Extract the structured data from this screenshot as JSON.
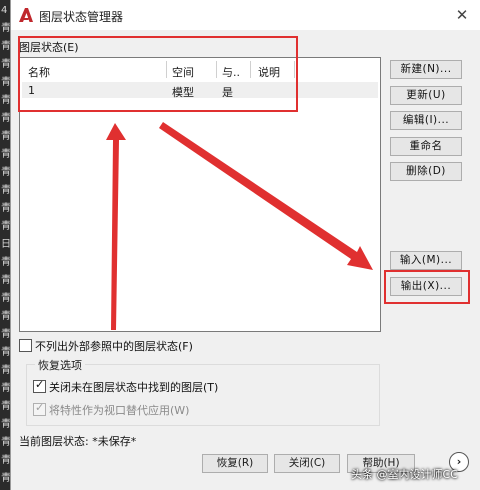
{
  "title": "图层状态管理器",
  "layer_states_label": "图层状态(E)",
  "columns": [
    "名称",
    "空间",
    "与..",
    "说明"
  ],
  "rows": [
    {
      "name": "1",
      "space": "模型",
      "same": "是",
      "desc": ""
    }
  ],
  "side_buttons": {
    "new": "新建(N)...",
    "update": "更新(U)",
    "edit": "编辑(I)...",
    "rename": "重命名",
    "delete": "删除(D)",
    "import": "输入(M)...",
    "export": "输出(X)..."
  },
  "exclude_xref_label": "不列出外部参照中的图层状态(F)",
  "restore_options": {
    "legend": "恢复选项",
    "close_not_found": "关闭未在图层状态中找到的图层(T)",
    "apply_as_override": "将特性作为视口替代应用(W)"
  },
  "current_state_label": "当前图层状态: *未保存*",
  "footer_buttons": {
    "restore": "恢复(R)",
    "close": "关闭(C)",
    "help": "帮助(H)"
  },
  "watermark": "头条 @室内设计师CC",
  "background_glyphs": [
    "4",
    "青",
    "青",
    "青",
    "青",
    "青",
    "青",
    "青",
    "青",
    "青",
    "青",
    "青",
    "青",
    "日",
    "青",
    "青",
    "青",
    "青",
    "青",
    "青",
    "青",
    "青",
    "青",
    "青",
    "青",
    "青",
    "青"
  ],
  "colors": {
    "annotation": "#e03030",
    "brand_red": "#c0282d"
  }
}
